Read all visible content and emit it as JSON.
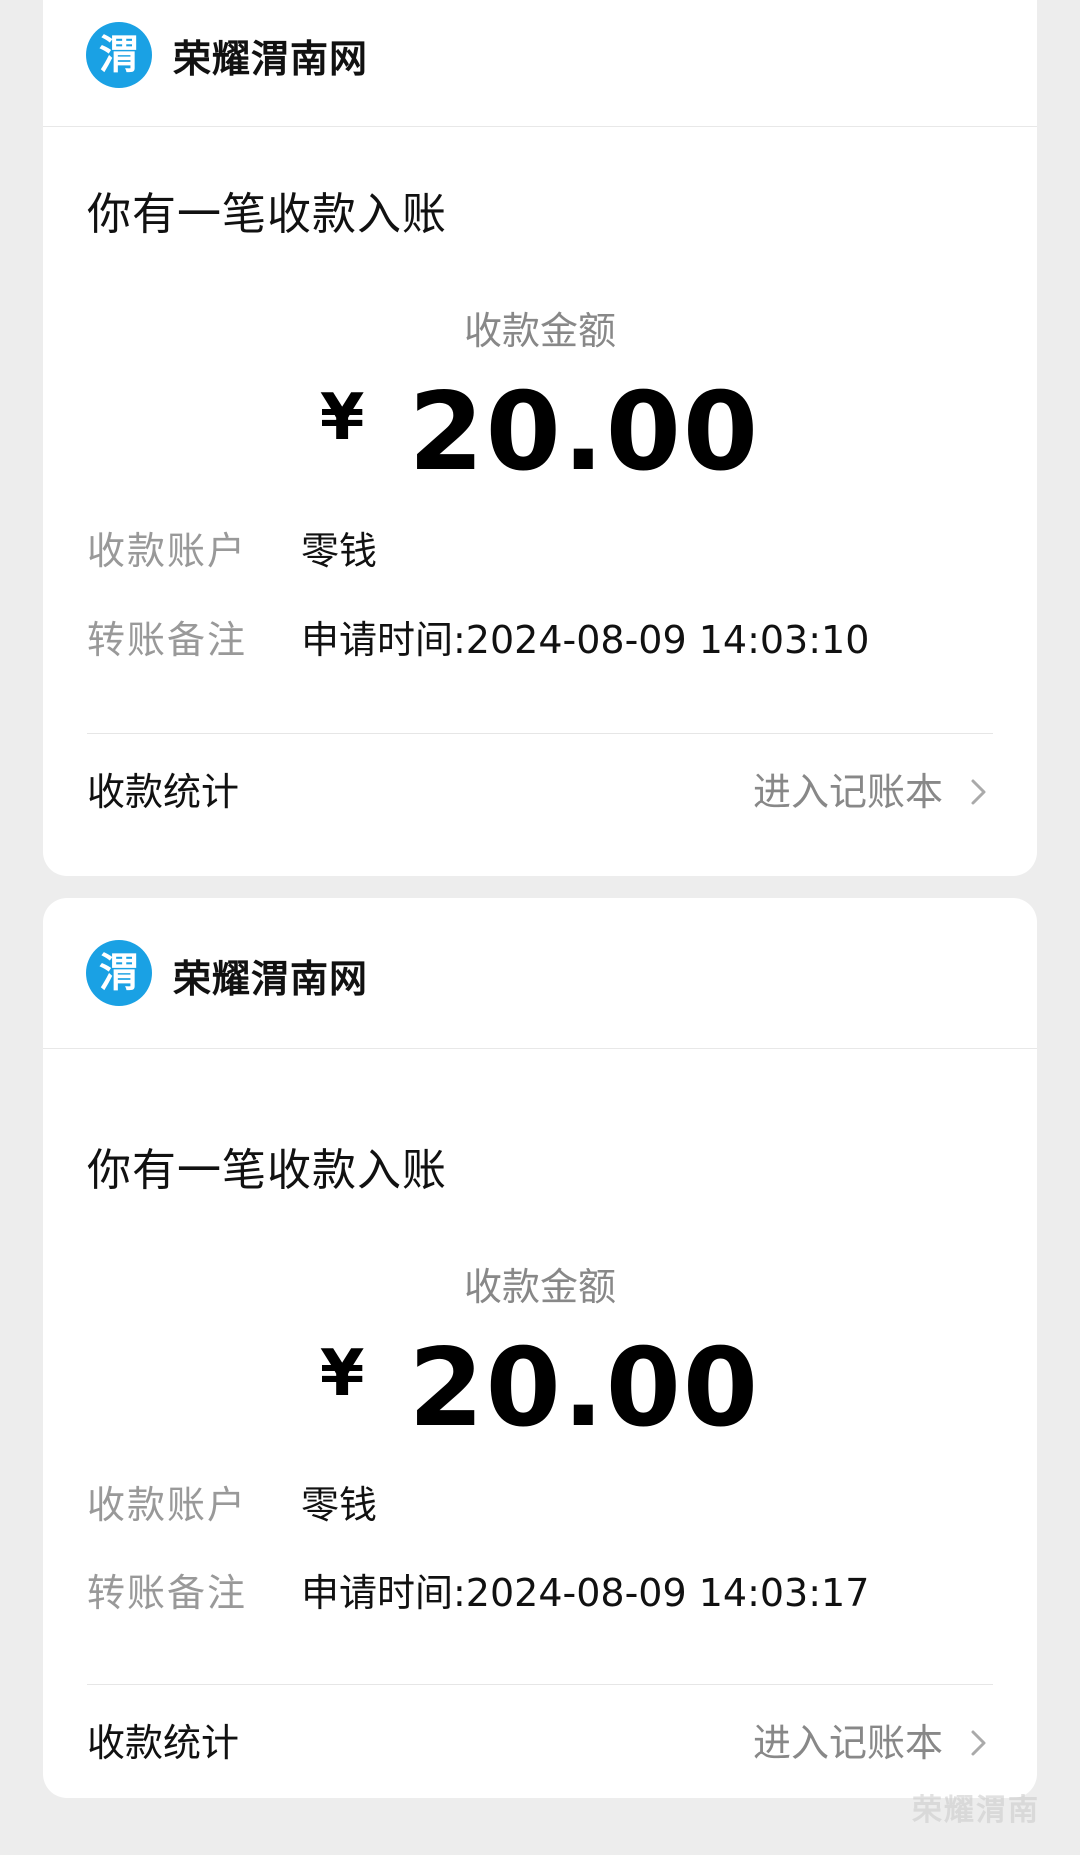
{
  "cards": [
    {
      "brand": "荣耀渭南网",
      "logo_char": "渭",
      "title": "你有一笔收款入账",
      "amount_label": "收款金额",
      "currency": "¥",
      "amount": "20.00",
      "account_label": "收款账户",
      "account_value": "零钱",
      "remark_label": "转账备注",
      "remark_value": "申请时间:2024-08-09 14:03:10",
      "stats_label": "收款统计",
      "ledger_link": "进入记账本",
      "chevron_icon": "chevron-right-icon"
    },
    {
      "brand": "荣耀渭南网",
      "logo_char": "渭",
      "title": "你有一笔收款入账",
      "amount_label": "收款金额",
      "currency": "¥",
      "amount": "20.00",
      "account_label": "收款账户",
      "account_value": "零钱",
      "remark_label": "转账备注",
      "remark_value": "申请时间:2024-08-09 14:03:17",
      "stats_label": "收款统计",
      "ledger_link": "进入记账本",
      "chevron_icon": "chevron-right-icon"
    }
  ],
  "watermark": "荣耀渭南",
  "colors": {
    "background": "#ededed",
    "card": "#ffffff",
    "logo": "#1aa1e4",
    "muted": "#888888"
  }
}
